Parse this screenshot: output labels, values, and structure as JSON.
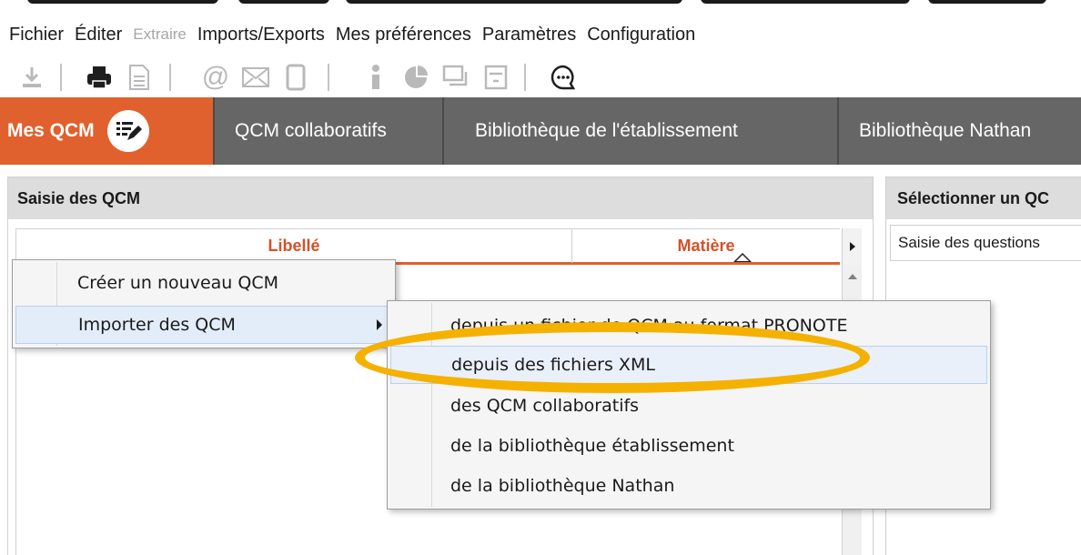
{
  "menubar": {
    "items": [
      "Fichier",
      "Éditer",
      "Extraire",
      "Imports/Exports",
      "Mes préférences",
      "Paramètres",
      "Configuration"
    ]
  },
  "toolbar": {
    "icons": [
      "download-icon",
      "print-icon",
      "document-icon",
      "at-icon",
      "mail-icon",
      "mobile-icon",
      "info-icon",
      "pie-chart-icon",
      "chat-icon",
      "form-icon",
      "chat-bubble-icon"
    ]
  },
  "tabs": [
    {
      "label": "Mes QCM",
      "active": true
    },
    {
      "label": "QCM collaboratifs",
      "active": false
    },
    {
      "label": "Bibliothèque de l'établissement",
      "active": false
    },
    {
      "label": "Bibliothèque Nathan",
      "active": false
    }
  ],
  "left_panel": {
    "title": "Saisie des QCM",
    "columns": [
      "Libellé",
      "Matière"
    ]
  },
  "right_panel": {
    "title": "Sélectionner un QC",
    "tab_label": "Saisie des questions"
  },
  "context_menu": {
    "items": [
      "Créer un nouveau QCM",
      "Importer des QCM"
    ]
  },
  "submenu": {
    "items": [
      "depuis un fichier de QCM au format PRONOTE",
      "depuis des fichiers XML",
      "des QCM collaboratifs",
      "de la bibliothèque établissement",
      "de la bibliothèque Nathan"
    ]
  },
  "colors": {
    "accent": "#e0612e",
    "tab_bar": "#5b5b5b",
    "highlight_ring": "#f5b100"
  }
}
